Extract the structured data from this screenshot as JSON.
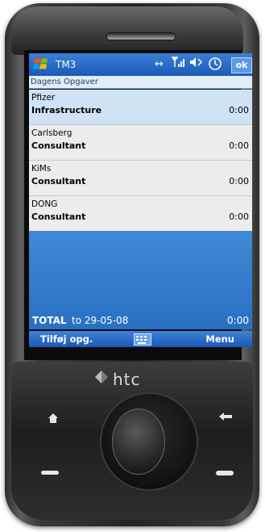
{
  "device": {
    "brand": "htc"
  },
  "statusbar": {
    "app_title": "TM3",
    "ok_label": "ok",
    "icons": [
      "sync-arrows-icon",
      "signal-icon",
      "volume-icon",
      "clock-icon"
    ]
  },
  "list": {
    "header": "Dagens Opgaver",
    "rows": [
      {
        "company": "Pfizer",
        "role": "Infrastructure",
        "time": "0:00",
        "selected": true
      },
      {
        "company": "Carlsberg",
        "role": "Consultant",
        "time": "0:00",
        "selected": false
      },
      {
        "company": "KiMs",
        "role": "Consultant",
        "time": "0:00",
        "selected": false
      },
      {
        "company": "DONG",
        "role": "Consultant",
        "time": "0:00",
        "selected": false
      }
    ]
  },
  "total": {
    "label": "TOTAL",
    "date_text": "to 29-05-08",
    "time": "0:00"
  },
  "softkeys": {
    "left": "Tilføj opg.",
    "right": "Menu"
  },
  "colors": {
    "accent": "#1c5ab8",
    "selected_row": "#cfe2f6",
    "row": "#ececec",
    "empty_area": "#2f77c8"
  }
}
